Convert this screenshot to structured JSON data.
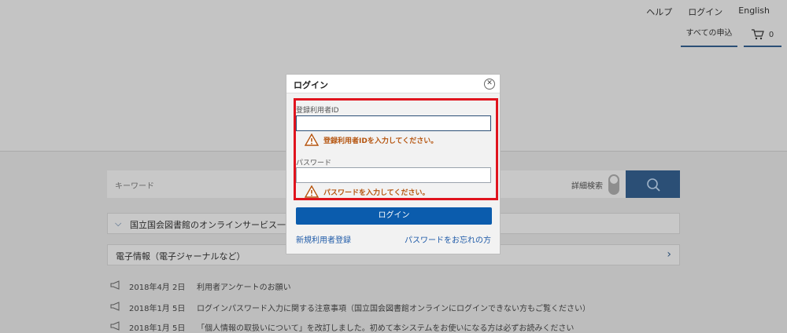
{
  "header": {
    "links": [
      "ヘルプ",
      "ログイン",
      "English"
    ],
    "apply_all": "すべての申込",
    "cart_count": "0",
    "cart_icon": "cart-icon"
  },
  "search": {
    "placeholder": "キーワード",
    "advanced_label": "詳細検索",
    "button_icon": "search-icon"
  },
  "panels": [
    {
      "label": "国立国会図書館のオンラインサービス一",
      "icon": "chevron-down-icon"
    },
    {
      "label": "電子情報（電子ジャーナルなど）",
      "icon": "chevron-right-icon"
    }
  ],
  "news": [
    {
      "date": "2018年4月 2日",
      "text": "利用者アンケートのお願い"
    },
    {
      "date": "2018年1月 5日",
      "text": "ログインパスワード入力に関する注意事項（国立国会図書館オンラインにログインできない方もご覧ください）"
    },
    {
      "date": "2018年1月 5日",
      "text": "「個人情報の取扱いについて」を改訂しました。初めて本システムをお使いになる方は必ずお読みください"
    }
  ],
  "modal": {
    "title": "ログイン",
    "close_icon": "close-icon",
    "user_id_label": "登録利用者ID",
    "user_id_value": "",
    "user_id_error": "登録利用者IDを入力してください。",
    "password_label": "パスワード",
    "password_value": "",
    "password_error": "パスワードを入力してください。",
    "login_button": "ログイン",
    "register_link": "新規利用者登録",
    "forgot_link": "パスワードをお忘れの方"
  },
  "colors": {
    "accent": "#2b4f76",
    "login_button": "#0b5cad",
    "highlight_border": "#e0141e",
    "error_text": "#b5540e"
  }
}
